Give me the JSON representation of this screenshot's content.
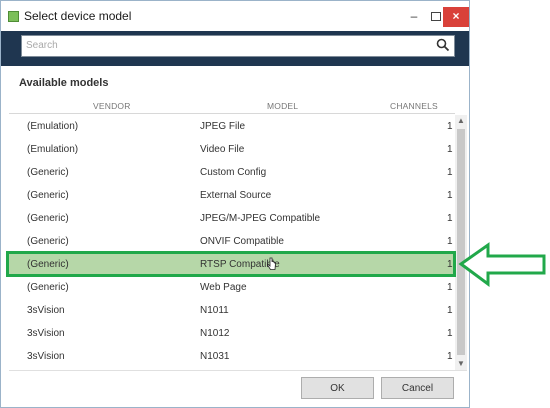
{
  "window": {
    "title": "Select device model",
    "minimize_glyph": "–",
    "close_glyph": "×"
  },
  "search": {
    "placeholder": "Search"
  },
  "section_title": "Available models",
  "columns": {
    "vendor": "VENDOR",
    "model": "MODEL",
    "channels": "CHANNELS"
  },
  "models": [
    {
      "vendor": "(Emulation)",
      "model": "JPEG File",
      "channels": "1"
    },
    {
      "vendor": "(Emulation)",
      "model": "Video File",
      "channels": "1"
    },
    {
      "vendor": "(Generic)",
      "model": "Custom Config",
      "channels": "1"
    },
    {
      "vendor": "(Generic)",
      "model": "External Source",
      "channels": "1"
    },
    {
      "vendor": "(Generic)",
      "model": "JPEG/M-JPEG Compatible",
      "channels": "1"
    },
    {
      "vendor": "(Generic)",
      "model": "ONVIF Compatible",
      "channels": "1"
    },
    {
      "vendor": "(Generic)",
      "model": "RTSP Compatible",
      "channels": "1"
    },
    {
      "vendor": "(Generic)",
      "model": "Web Page",
      "channels": "1"
    },
    {
      "vendor": "3sVision",
      "model": "N1011",
      "channels": "1"
    },
    {
      "vendor": "3sVision",
      "model": "N1012",
      "channels": "1"
    },
    {
      "vendor": "3sVision",
      "model": "N1031",
      "channels": "1"
    }
  ],
  "selected_index": 6,
  "buttons": {
    "ok": "OK",
    "cancel": "Cancel"
  },
  "colors": {
    "header_band": "#1f3650",
    "selected_row": "#b6d7a8",
    "highlight": "#21a84a",
    "close_button": "#d9413a"
  },
  "icons": {
    "app": "device-app-icon",
    "search": "search-icon",
    "scroll_up": "scroll-up-arrow-icon",
    "scroll_down": "scroll-down-arrow-icon",
    "annotation": "right-pointing-arrow-outline"
  }
}
